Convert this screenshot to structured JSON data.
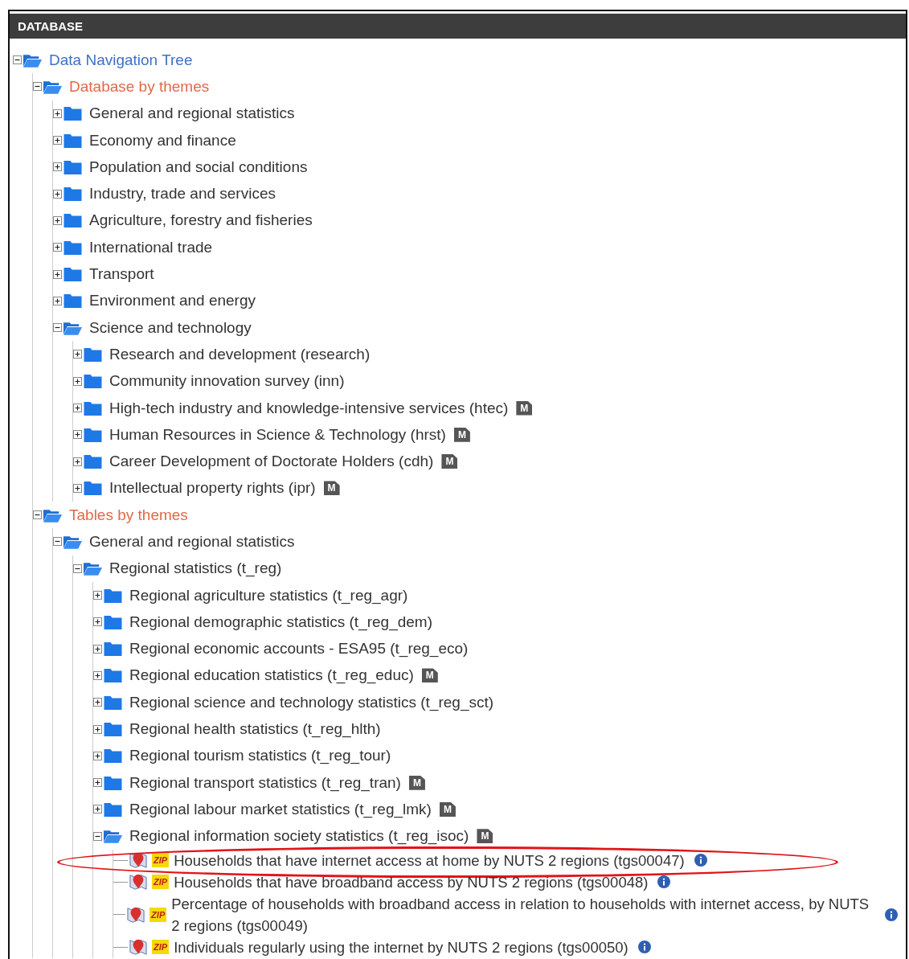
{
  "panel": {
    "title": "DATABASE"
  },
  "tree": [
    {
      "kind": "root",
      "label": "Data Navigation Tree",
      "expanded": true,
      "children": [
        {
          "kind": "section",
          "label": "Database by themes",
          "expanded": true,
          "children": [
            {
              "kind": "folder",
              "label": "General and regional statistics",
              "expanded": false
            },
            {
              "kind": "folder",
              "label": "Economy and finance",
              "expanded": false
            },
            {
              "kind": "folder",
              "label": "Population and social conditions",
              "expanded": false
            },
            {
              "kind": "folder",
              "label": "Industry, trade and services",
              "expanded": false
            },
            {
              "kind": "folder",
              "label": "Agriculture, forestry and fisheries",
              "expanded": false
            },
            {
              "kind": "folder",
              "label": "International trade",
              "expanded": false
            },
            {
              "kind": "folder",
              "label": "Transport",
              "expanded": false
            },
            {
              "kind": "folder",
              "label": "Environment and energy",
              "expanded": false
            },
            {
              "kind": "folder",
              "label": "Science and technology",
              "expanded": true,
              "children": [
                {
                  "kind": "folder",
                  "label": "Research and development (research)",
                  "expanded": false
                },
                {
                  "kind": "folder",
                  "label": "Community innovation survey (inn)",
                  "expanded": false
                },
                {
                  "kind": "folder",
                  "label": "High-tech industry and knowledge-intensive services (htec)",
                  "expanded": false,
                  "badge": "M"
                },
                {
                  "kind": "folder",
                  "label": "Human Resources in Science & Technology (hrst)",
                  "expanded": false,
                  "badge": "M"
                },
                {
                  "kind": "folder",
                  "label": "Career Development of Doctorate Holders (cdh)",
                  "expanded": false,
                  "badge": "M"
                },
                {
                  "kind": "folder",
                  "label": "Intellectual property rights (ipr)",
                  "expanded": false,
                  "badge": "M"
                }
              ]
            }
          ]
        },
        {
          "kind": "section",
          "label": "Tables by themes",
          "expanded": true,
          "children": [
            {
              "kind": "folder",
              "label": "General and regional statistics",
              "expanded": true,
              "children": [
                {
                  "kind": "folder",
                  "label": "Regional statistics (t_reg)",
                  "expanded": true,
                  "children": [
                    {
                      "kind": "folder",
                      "label": "Regional agriculture statistics (t_reg_agr)",
                      "expanded": false
                    },
                    {
                      "kind": "folder",
                      "label": "Regional demographic statistics (t_reg_dem)",
                      "expanded": false
                    },
                    {
                      "kind": "folder",
                      "label": "Regional economic accounts - ESA95 (t_reg_eco)",
                      "expanded": false
                    },
                    {
                      "kind": "folder",
                      "label": "Regional education statistics (t_reg_educ)",
                      "expanded": false,
                      "badge": "M"
                    },
                    {
                      "kind": "folder",
                      "label": "Regional science and technology statistics (t_reg_sct)",
                      "expanded": false
                    },
                    {
                      "kind": "folder",
                      "label": "Regional health statistics (t_reg_hlth)",
                      "expanded": false
                    },
                    {
                      "kind": "folder",
                      "label": "Regional tourism statistics (t_reg_tour)",
                      "expanded": false
                    },
                    {
                      "kind": "folder",
                      "label": "Regional transport statistics (t_reg_tran)",
                      "expanded": false,
                      "badge": "M"
                    },
                    {
                      "kind": "folder",
                      "label": "Regional labour market statistics (t_reg_lmk)",
                      "expanded": false,
                      "badge": "M"
                    },
                    {
                      "kind": "folder",
                      "label": "Regional information society statistics (t_reg_isoc)",
                      "expanded": true,
                      "badge": "M",
                      "children": [
                        {
                          "kind": "table",
                          "label": "Households that have internet access at home by NUTS 2 regions (tgs00047)",
                          "zip": "ZIP",
                          "highlighted": true
                        },
                        {
                          "kind": "table",
                          "label": "Households that have broadband access by NUTS 2 regions (tgs00048)",
                          "zip": "ZIP",
                          "highlighted": false
                        },
                        {
                          "kind": "table",
                          "label": "Percentage of households with broadband access in relation to households with internet access, by NUTS 2 regions (tgs00049)",
                          "zip": "ZIP",
                          "highlighted": false
                        },
                        {
                          "kind": "table",
                          "label": "Individuals regularly using the internet by NUTS 2 regions (tgs00050)",
                          "zip": "ZIP",
                          "highlighted": false
                        }
                      ]
                    }
                  ]
                }
              ]
            }
          ]
        }
      ]
    }
  ]
}
